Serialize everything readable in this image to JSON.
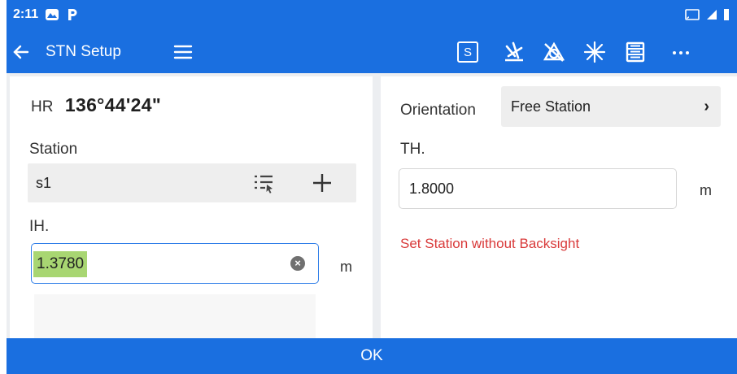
{
  "status_bar": {
    "time": "2:11",
    "notification_icons": [
      "gallery-icon",
      "parking-icon"
    ],
    "right_icons": [
      "cast-icon",
      "signal-icon",
      "battery-icon"
    ]
  },
  "app_bar": {
    "title": "STN Setup",
    "s_button_label": "S",
    "toolbar_icons": [
      "laser-pointer-icon",
      "no-prism-icon",
      "illumination-icon",
      "layer-settings-icon",
      "more-icon"
    ]
  },
  "left_panel": {
    "hr_label": "HR",
    "hr_value": "136°44'24\"",
    "station_label": "Station",
    "station_value": "s1",
    "ih_label": "IH.",
    "ih_value": "1.3780",
    "ih_unit": "m"
  },
  "right_panel": {
    "orientation_label": "Orientation",
    "orientation_value": "Free Station",
    "th_label": "TH.",
    "th_value": "1.8000",
    "th_unit": "m",
    "warning": "Set Station without Backsight"
  },
  "ok_label": "OK",
  "colors": {
    "primary": "#1a6fe0",
    "warning": "#d93a3a",
    "selection": "#a8d672"
  }
}
